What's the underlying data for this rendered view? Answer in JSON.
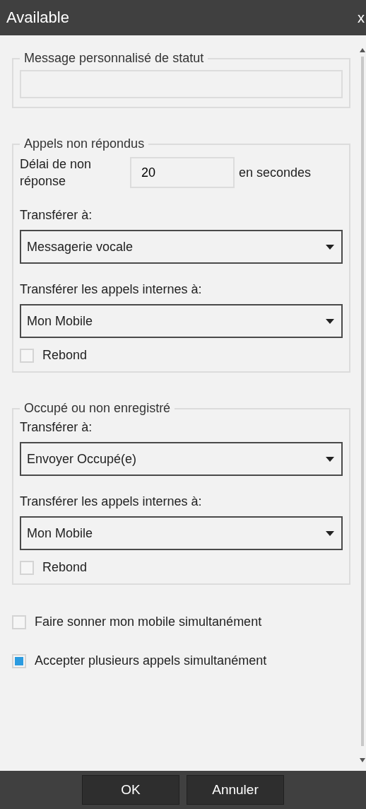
{
  "window": {
    "title": "Available",
    "close": "x"
  },
  "status_message": {
    "legend": "Message personnalisé de statut"
  },
  "sections": [
    {
      "legend": "Appels non répondus",
      "timeout": {
        "label": "Délai de non réponse",
        "value": "20",
        "unit": "en secondes"
      },
      "fields": [
        {
          "label": "Transférer à:",
          "value": "Messagerie vocale"
        },
        {
          "label": "Transférer les appels internes à:",
          "value": "Mon Mobile"
        }
      ],
      "rebound": {
        "label": "Rebond",
        "checked": false
      }
    },
    {
      "legend": "Occupé ou non enregistré",
      "fields": [
        {
          "label": "Transférer à:",
          "value": "Envoyer Occupé(e)"
        },
        {
          "label": "Transférer les appels internes à:",
          "value": "Mon Mobile"
        }
      ],
      "rebound": {
        "label": "Rebond",
        "checked": false
      }
    }
  ],
  "options": [
    {
      "label": "Faire sonner mon mobile simultanément",
      "checked": false
    },
    {
      "label": "Accepter plusieurs appels simultanément",
      "checked": true
    }
  ],
  "buttons": [
    "OK",
    "Annuler"
  ]
}
